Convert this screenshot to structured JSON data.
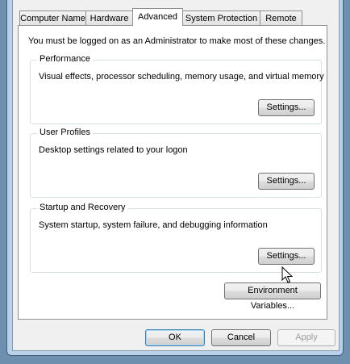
{
  "tabs": [
    {
      "label": "Computer Name"
    },
    {
      "label": "Hardware"
    },
    {
      "label": "Advanced"
    },
    {
      "label": "System Protection"
    },
    {
      "label": "Remote"
    }
  ],
  "active_tab": "Advanced",
  "admin_note": "You must be logged on as an Administrator to make most of these changes.",
  "performance": {
    "title": "Performance",
    "description": "Visual effects, processor scheduling, memory usage, and virtual memory",
    "button": "Settings..."
  },
  "user_profiles": {
    "title": "User Profiles",
    "description": "Desktop settings related to your logon",
    "button": "Settings..."
  },
  "startup_recovery": {
    "title": "Startup and Recovery",
    "description": "System startup, system failure, and debugging information",
    "button": "Settings..."
  },
  "env_button": "Environment Variables...",
  "footer": {
    "ok": "OK",
    "cancel": "Cancel",
    "apply": "Apply"
  },
  "icons": {
    "cursor": "pointer-cursor-icon"
  }
}
